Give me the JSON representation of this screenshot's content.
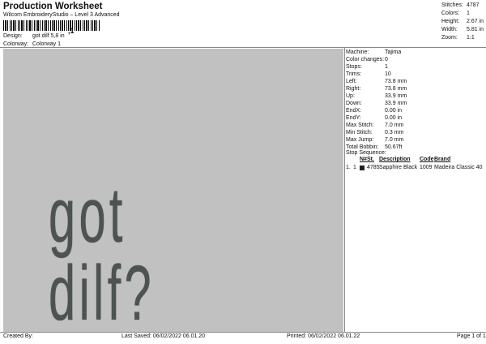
{
  "header": {
    "title": "Production Worksheet",
    "subtitle": "Wilcom EmbroideryStudio – Level 3 Advanced",
    "barcode_suffix": ",1"
  },
  "design_info": {
    "design_label": "Design:",
    "design_value": "got dilf 5,8 in",
    "colorway_label": "Colorway:",
    "colorway_value": "Colorway 1"
  },
  "top_stats": [
    {
      "label": "Stitches:",
      "value": "4787"
    },
    {
      "label": "Colors:",
      "value": "1"
    },
    {
      "label": "Height:",
      "value": "2.67 in"
    },
    {
      "label": "Width:",
      "value": "5.81 in"
    },
    {
      "label": "Zoom:",
      "value": "1:1"
    }
  ],
  "canvas": {
    "design_text": "got dilf?",
    "background": "#c1c1c1",
    "thread_color": "#4d5353"
  },
  "machine_info": [
    {
      "label": "Machine:",
      "value": "Tajima"
    },
    {
      "label": "Color changes:",
      "value": "0"
    },
    {
      "label": "Stops:",
      "value": "1"
    },
    {
      "label": "Trims:",
      "value": "10"
    },
    {
      "label": "Left:",
      "value": "73.8 mm"
    },
    {
      "label": "Right:",
      "value": "73.8 mm"
    },
    {
      "label": "Up:",
      "value": "33.9 mm"
    },
    {
      "label": "Down:",
      "value": "33.9 mm"
    },
    {
      "label": "EndX:",
      "value": "0.00 in"
    },
    {
      "label": "EndY:",
      "value": "0.00 in"
    },
    {
      "label": "Max Stitch:",
      "value": "7.0 mm"
    },
    {
      "label": "Min Stitch:",
      "value": "0.3 mm"
    },
    {
      "label": "Max Jump:",
      "value": "7.0 mm"
    },
    {
      "label": "Total Bobbin:",
      "value": "50.67ft"
    }
  ],
  "stop_sequence": {
    "label": "Stop Sequence:",
    "headers": {
      "n": "N#",
      "st": "St.",
      "description": "Description",
      "code": "Code",
      "brand": "Brand"
    },
    "rows": [
      {
        "index": "1.",
        "n": "1",
        "st": "4785",
        "description": "Sapphire Black",
        "code": "1009",
        "brand": "Madeira Classic 40",
        "swatch": "#222222"
      }
    ]
  },
  "footer": {
    "created_by": "Created By:",
    "last_saved": "Last Saved: 06/02/2022 06.01.20",
    "printed": "Printed: 06/02/2022 06.01.22",
    "page": "Page 1 of 1"
  }
}
